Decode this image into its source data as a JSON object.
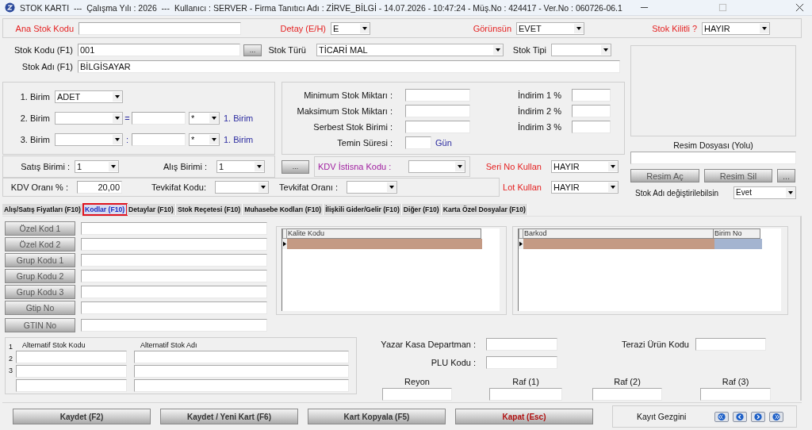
{
  "window": {
    "title": "STOK KARTI  ---  Çalışma Yılı : 2026  ---  Kullanıcı : SERVER - Firma Tanıtıcı Adı : ZİRVE_BİLGİ - 14.07.2026 - 10:47:24 - Müş.No : 424417 - Ver.No : 060726-06.1"
  },
  "top_fields": [
    {
      "label": "Ana Stok Kodu",
      "kind": "text"
    },
    {
      "label": "Detay (E/H)",
      "kind": "combo",
      "value": "E"
    },
    {
      "label": "Görünsün",
      "kind": "combo",
      "value": "EVET"
    },
    {
      "label": "Stok Kilitli ?",
      "kind": "combo",
      "value": "HAYIR"
    }
  ],
  "stock": {
    "code": {
      "label": "Stok Kodu (F1)",
      "value": "001"
    },
    "browse_button": "...",
    "type": {
      "label": "Stok Türü",
      "value": "TİCARİ MAL"
    },
    "tip": {
      "label": "Stok Tipi"
    },
    "name": {
      "label": "Stok Adı (F1)",
      "value": "BİLGİSAYAR"
    }
  },
  "units": [
    {
      "label": "1. Birim",
      "value": "ADET"
    },
    {
      "label": "2. Birim",
      "separator": "=",
      "multiplier": "*",
      "ref": "1. Birim"
    },
    {
      "label": "3. Birim",
      "separator": ":",
      "multiplier": "*",
      "ref": "1. Birim"
    }
  ],
  "limits": [
    {
      "label": "Minimum Stok Miktarı :"
    },
    {
      "label": "Maksimum Stok Miktarı :"
    },
    {
      "label": "Serbest Stok Birimi :"
    },
    {
      "label": "Temin Süresi :",
      "unit": "Gün"
    }
  ],
  "discounts": [
    {
      "label": "İndirim 1 %"
    },
    {
      "label": "İndirim 2 %"
    },
    {
      "label": "İndirim 3 %"
    }
  ],
  "image_file": {
    "label": "Resim Dosyası (Yolu)",
    "buttons": [
      "Resim Aç",
      "Resim Sil",
      "..."
    ]
  },
  "rename": {
    "label": "Stok Adı değiştirilebilsin",
    "value": "Evet"
  },
  "sale_unit": {
    "label": "Satış Birimi :",
    "value": "1"
  },
  "purchase_unit": {
    "label": "Alış Birimi :",
    "value": "1"
  },
  "kdv_button": "...",
  "kdv_exemption": {
    "label": "KDV İstisna Kodu :"
  },
  "serial": {
    "label": "Seri No Kullan",
    "value": "HAYIR"
  },
  "vat_rate": {
    "label": "KDV Oranı % :",
    "value": "20,00"
  },
  "withholding_code": {
    "label": "Tevkifat Kodu:"
  },
  "withholding_rate": {
    "label": "Tevkifat Oranı :"
  },
  "lot": {
    "label": "Lot Kullan",
    "value": "HAYIR"
  },
  "tabs": [
    {
      "label": "Alış/Satış Fiyatları (F10)",
      "selected": false
    },
    {
      "label": "Kodlar (F10)",
      "selected": true
    },
    {
      "label": "Detaylar (F10)",
      "selected": false
    },
    {
      "label": "Stok Reçetesi (F10)",
      "selected": false
    },
    {
      "label": "Muhasebe Kodları (F10)",
      "selected": false
    },
    {
      "label": "İlişkili Gider/Gelir (F10)",
      "selected": false
    },
    {
      "label": "Diğer (F10)",
      "selected": false
    },
    {
      "label": "Karta Özel Dosyalar (F10)",
      "selected": false
    }
  ],
  "code_buttons": [
    "Özel Kod 1",
    "Özel Kod 2",
    "Grup Kodu 1",
    "Grup Kodu 2",
    "Grup Kodu 3",
    "Gtip No",
    "GTIN No"
  ],
  "quality_grid": {
    "columns": [
      "Kalite Kodu"
    ]
  },
  "barcode_grid": {
    "columns": [
      "Barkod",
      "Birim No"
    ]
  },
  "alternatives": {
    "row_numbers": [
      "1",
      "2",
      "3"
    ],
    "columns": [
      "Alternatif Stok Kodu",
      "Alternatif Stok Adı"
    ]
  },
  "pos": {
    "department": "Yazar Kasa Departman :",
    "scale_code": "Terazi Ürün Kodu",
    "plu": "PLU Kodu :",
    "shelves": [
      "Reyon",
      "Raf (1)",
      "Raf (2)",
      "Raf (3)"
    ]
  },
  "footer": {
    "buttons": [
      {
        "label": "Kaydet (F2)",
        "kind": "normal"
      },
      {
        "label": "Kaydet / Yeni Kart (F6)",
        "kind": "normal"
      },
      {
        "label": "Kart Kopyala (F5)",
        "kind": "normal"
      },
      {
        "label": "Kapat (Esc)",
        "kind": "danger"
      }
    ],
    "navigator": "Kayıt Gezgini"
  }
}
